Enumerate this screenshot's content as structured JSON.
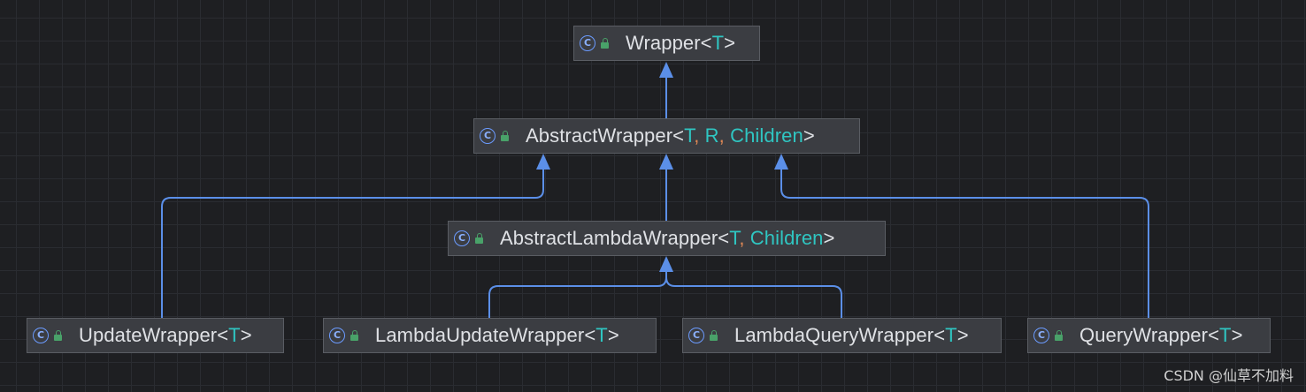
{
  "diagram": {
    "nodes": [
      {
        "id": "wrapper",
        "base": "Wrapper",
        "params": [
          "T"
        ]
      },
      {
        "id": "abstract-wrapper",
        "base": "AbstractWrapper",
        "params": [
          "T",
          "R",
          "Children"
        ]
      },
      {
        "id": "abstract-lambda-wrapper",
        "base": "AbstractLambdaWrapper",
        "params": [
          "T",
          "Children"
        ]
      },
      {
        "id": "update-wrapper",
        "base": "UpdateWrapper",
        "params": [
          "T"
        ]
      },
      {
        "id": "lambda-update-wrapper",
        "base": "LambdaUpdateWrapper",
        "params": [
          "T"
        ]
      },
      {
        "id": "lambda-query-wrapper",
        "base": "LambdaQueryWrapper",
        "params": [
          "T"
        ]
      },
      {
        "id": "query-wrapper",
        "base": "QueryWrapper",
        "params": [
          "T"
        ]
      }
    ],
    "edges": [
      {
        "from": "abstract-wrapper",
        "to": "wrapper"
      },
      {
        "from": "abstract-lambda-wrapper",
        "to": "abstract-wrapper"
      },
      {
        "from": "update-wrapper",
        "to": "abstract-wrapper"
      },
      {
        "from": "query-wrapper",
        "to": "abstract-wrapper"
      },
      {
        "from": "lambda-update-wrapper",
        "to": "abstract-lambda-wrapper"
      },
      {
        "from": "lambda-query-wrapper",
        "to": "abstract-lambda-wrapper"
      }
    ],
    "icons": {
      "class": "class-icon",
      "access": "lock-icon"
    },
    "colors": {
      "background": "#1e1f22",
      "node_fill": "#3b3d42",
      "type_param": "#2fc6c2",
      "comma": "#e08855",
      "edge": "#5b8fe8"
    }
  },
  "watermark": "CSDN @仙草不加料"
}
